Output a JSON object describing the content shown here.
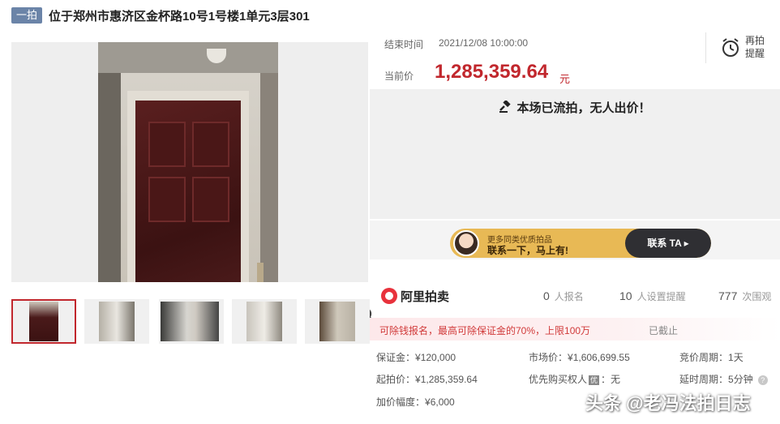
{
  "header": {
    "badge": "一拍",
    "title": "位于郑州市惠济区金杯路10号1号楼1单元3层301"
  },
  "auction": {
    "end_label": "结束时间",
    "end_time": "2021/12/08 10:00:00",
    "remind_label": "再拍提醒",
    "price_label": "当前价",
    "current_price": "1,285,359.64",
    "price_unit": "元",
    "status_message": "本场已流拍，无人出价！"
  },
  "banner": {
    "line1": "更多同类优质拍品",
    "line2": "联系一下，马上有!",
    "cta": "联系 TA ▸"
  },
  "brand": {
    "logo_text": "阿里拍卖"
  },
  "stats": [
    {
      "num": "0",
      "label": "人报名"
    },
    {
      "num": "10",
      "label": "人设置提醒"
    },
    {
      "num": "777",
      "label": "次围观"
    }
  ],
  "notice": {
    "text": "可除钱报名，最高可除保证金的70%，上限100万",
    "state": "已截止"
  },
  "details": {
    "deposit_label": "保证金：",
    "deposit_value": "¥120,000",
    "start_label": "起拍价：",
    "start_value": "¥1,285,359.64",
    "increment_label": "加价幅度：",
    "increment_value": "¥6,000",
    "market_label": "市场价：",
    "market_value": "¥1,606,699.55",
    "priority_label": "优先购买权人",
    "priority_tag": "优",
    "priority_value": "：无",
    "cycle_label": "竞价周期：",
    "cycle_value": "1天",
    "delay_label": "延时周期：",
    "delay_value": "5分钟"
  },
  "watermark": "头条 @老冯法拍日志",
  "colors": {
    "accent_red": "#c1272d",
    "badge_blue": "#6b84a8",
    "banner_gold": "#e8b955"
  },
  "icons": [
    "zoom-icon",
    "alarm-clock-icon",
    "gavel-icon",
    "help-icon"
  ]
}
